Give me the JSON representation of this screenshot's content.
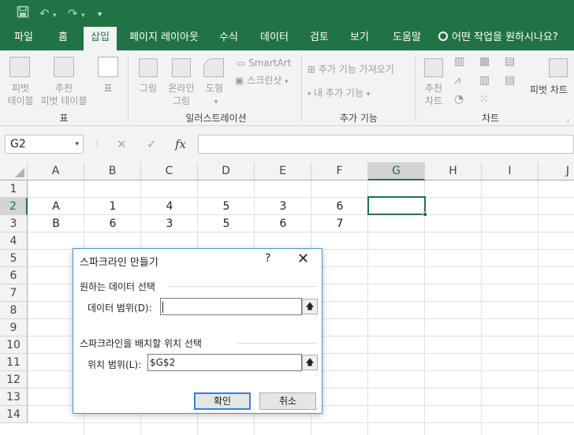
{
  "quick_access": {
    "save_icon": "save-icon",
    "undo_icon": "undo-icon",
    "redo_icon": "redo-icon",
    "customize_icon": "customize-qat-icon"
  },
  "tabs": [
    {
      "label": "파일"
    },
    {
      "label": "홈"
    },
    {
      "label": "삽입"
    },
    {
      "label": "페이지 레이아웃"
    },
    {
      "label": "수식"
    },
    {
      "label": "데이터"
    },
    {
      "label": "검토"
    },
    {
      "label": "보기"
    },
    {
      "label": "도움말"
    }
  ],
  "tell_me": "어떤 작업을 원하시나요?",
  "ribbon": {
    "tables": {
      "pivot": "피벗\n테이블",
      "recommended": "추천\n피벗 테이블",
      "table": "표",
      "group": "표"
    },
    "illustrations": {
      "picture": "그림",
      "online": "온라인\n그림",
      "shapes": "도형",
      "smartart": "SmartArt",
      "screenshot": "스크린샷",
      "group": "일러스트레이션"
    },
    "addins": {
      "get": "추가 기능 가져오기",
      "my": "내 추가 기능",
      "group": "추가 기능"
    },
    "charts": {
      "recommended": "추천\n차트",
      "pivot": "피벗 차트",
      "group": "차트"
    }
  },
  "formula_bar": {
    "name_box": "G2",
    "fx": "fx",
    "formula": ""
  },
  "columns": [
    "A",
    "B",
    "C",
    "D",
    "E",
    "F",
    "G",
    "H",
    "I",
    "J"
  ],
  "rows": [
    "1",
    "2",
    "3",
    "4",
    "5",
    "6",
    "7",
    "8",
    "9",
    "10",
    "11",
    "12",
    "13",
    "14"
  ],
  "cells": {
    "row2": [
      "A",
      "1",
      "4",
      "5",
      "3",
      "6"
    ],
    "row3": [
      "B",
      "6",
      "3",
      "5",
      "6",
      "7"
    ]
  },
  "selected_cell": "G2",
  "dialog": {
    "title": "스파크라인 만들기",
    "help": "?",
    "close": "✕",
    "section_data": "원하는 데이터 선택",
    "data_range_label": "데이터 범위(D):",
    "data_range_value": "",
    "section_location": "스파크라인을 배치할 위치 선택",
    "location_range_label": "위치 범위(L):",
    "location_range_value": "$G$2",
    "ok_label": "확인",
    "cancel_label": "취소"
  }
}
